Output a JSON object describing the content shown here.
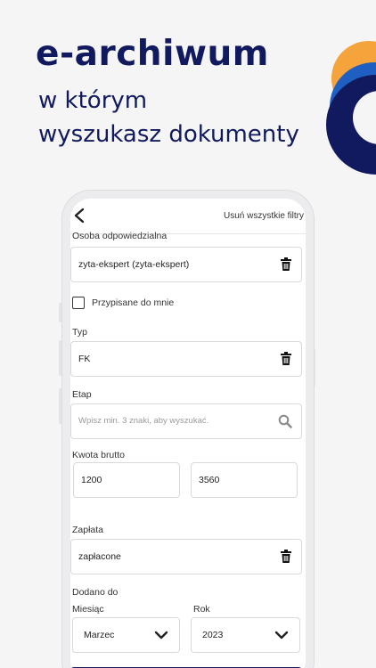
{
  "hero": {
    "headline": "e-archiwum",
    "sub_line1": "w którym",
    "sub_line2": "wyszukasz dokumenty"
  },
  "colors": {
    "navy": "#111a5e",
    "orange": "#f5a33b",
    "blue": "#1f5fc2",
    "button": "#141c5f"
  },
  "topbar": {
    "back_icon": "chevron-left-icon",
    "clear_filters": "Usuń wszystkie filtry"
  },
  "filters": {
    "person": {
      "label": "Osoba odpowiedzialna",
      "value": "zyta-ekspert (zyta-ekspert)"
    },
    "assigned": {
      "label": "Przypisane do mnie",
      "checked": false
    },
    "type": {
      "label": "Typ",
      "value": "FK"
    },
    "stage": {
      "label": "Etap",
      "placeholder": "Wpisz min. 3 znaki, aby wyszukać."
    },
    "gross": {
      "label": "Kwota brutto",
      "from": "1200",
      "to": "3560"
    },
    "payment": {
      "label": "Zapłata",
      "value": "zapłacone"
    },
    "added": {
      "label": "Dodano do",
      "month_label": "Miesiąc",
      "month_value": "Marzec",
      "year_label": "Rok",
      "year_value": "2023"
    }
  }
}
